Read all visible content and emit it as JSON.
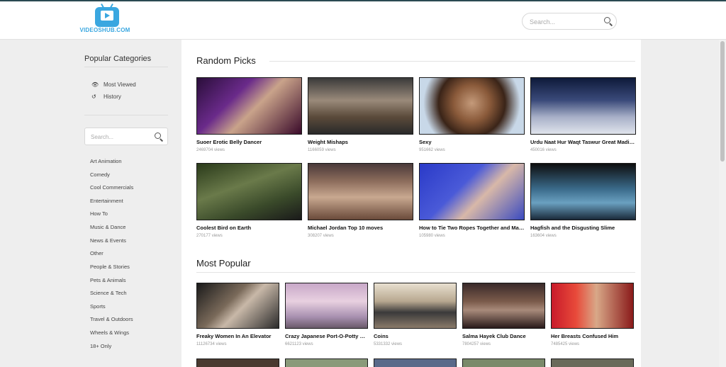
{
  "header": {
    "logo_text": "VIDEOSHUB.COM",
    "search_placeholder": "Search..."
  },
  "sidebar": {
    "title": "Popular Categories",
    "links": [
      {
        "label": "Most Viewed",
        "icon": "eye-icon"
      },
      {
        "label": "History",
        "icon": "history-icon"
      }
    ],
    "search_placeholder": "Search...",
    "categories": [
      "Art Animation",
      "Comedy",
      "Cool Commercials",
      "Entertainment",
      "How To",
      "Music & Dance",
      "News & Events",
      "Other",
      "People & Stories",
      "Pets & Animals",
      "Science & Tech",
      "Sports",
      "Travel & Outdoors",
      "Wheels & Wings",
      "18+ Only"
    ]
  },
  "random_picks": {
    "title": "Random Picks",
    "videos": [
      {
        "title": "Suoer Erotic Belly Dancer",
        "views": "2469704 views"
      },
      {
        "title": "Weight Mishaps",
        "views": "1166059 views"
      },
      {
        "title": "Sexy",
        "views": "951662 views"
      },
      {
        "title": "Urdu Naat Hur Waqt Taswur Great Madina Ho",
        "views": "450016 views"
      },
      {
        "title": "Coolest Bird on Earth",
        "views": "270177 views"
      },
      {
        "title": "Michael Jordan Top 10 moves",
        "views": "308207 views"
      },
      {
        "title": "How to Tie Two Ropes Together and Make Them Hold",
        "views": "105980 views"
      },
      {
        "title": "Hagfish and the Disgusting Slime",
        "views": "163604 views"
      }
    ]
  },
  "most_popular": {
    "title": "Most Popular",
    "videos": [
      {
        "title": "Freaky Women In An Elevator",
        "views": "11126734 views"
      },
      {
        "title": "Crazy Japanese Port-O-Potty Prank",
        "views": "6621123 views"
      },
      {
        "title": "Coins",
        "views": "5331332 views"
      },
      {
        "title": "Salma Hayek Club Dance",
        "views": "7804257 views"
      },
      {
        "title": "Her Breasts Confused Him",
        "views": "7485425 views"
      }
    ]
  },
  "colors": {
    "accent": "#3aa7e0",
    "top_line": "#2a4a52",
    "background": "#eeeeee"
  }
}
